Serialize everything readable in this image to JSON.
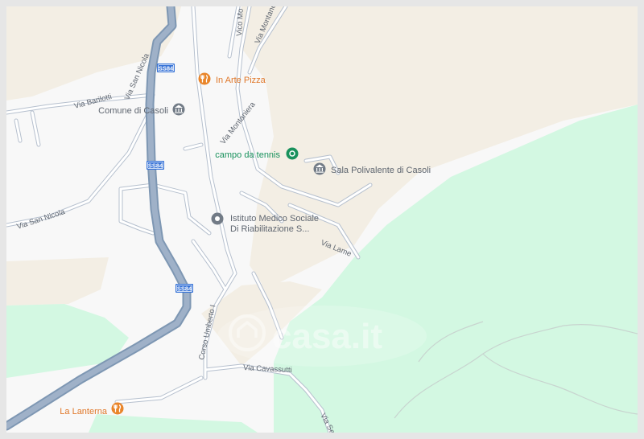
{
  "map": {
    "pois": [
      {
        "id": "in-arte-pizza",
        "name": "In Arte Pizza",
        "type": "restaurant"
      },
      {
        "id": "comune-di-casoli",
        "name": "Comune di Casoli",
        "type": "government"
      },
      {
        "id": "campo-da-tennis",
        "name": "campo da tennis",
        "type": "sports"
      },
      {
        "id": "sala-polivalente",
        "name": "Sala Polivalente di Casoli",
        "type": "venue"
      },
      {
        "id": "istituto-medico",
        "name_line1": "Istituto Medico Sociale",
        "name_line2": "Di Riabilitazione S...",
        "type": "medical"
      },
      {
        "id": "la-lanterna",
        "name": "La Lanterna",
        "type": "restaurant"
      }
    ],
    "streets": {
      "vico_mo": "Vico Mo",
      "via_montanera_top": "Via Montanera",
      "via_montaniera": "Via Montaniera",
      "via_san_nicola_top": "Via San Nicola",
      "via_barilotti": "Via Barilotti",
      "via_san_nicola_left": "Via San Nicola",
      "via_lame": "Via Lame",
      "corso_umberto": "Corso Umberto I",
      "via_cavassutti": "Via Cavassutti",
      "via_se": "Via Se"
    },
    "road_shields": [
      "SS84",
      "SS84",
      "SS84"
    ],
    "watermark": "casa.it",
    "colors": {
      "land": "#f8f8f8",
      "sand": "#f3eee4",
      "green": "#d3f8e2",
      "minor_road": "#b3becf",
      "road_fill": "#ffffff",
      "highway_casing": "#7e97b3",
      "highway_fill": "#9fb1c8",
      "food_poi": "#e9852a",
      "gray_poi": "#727b86",
      "green_poi": "#18915c",
      "shield": "#3471d6"
    }
  }
}
